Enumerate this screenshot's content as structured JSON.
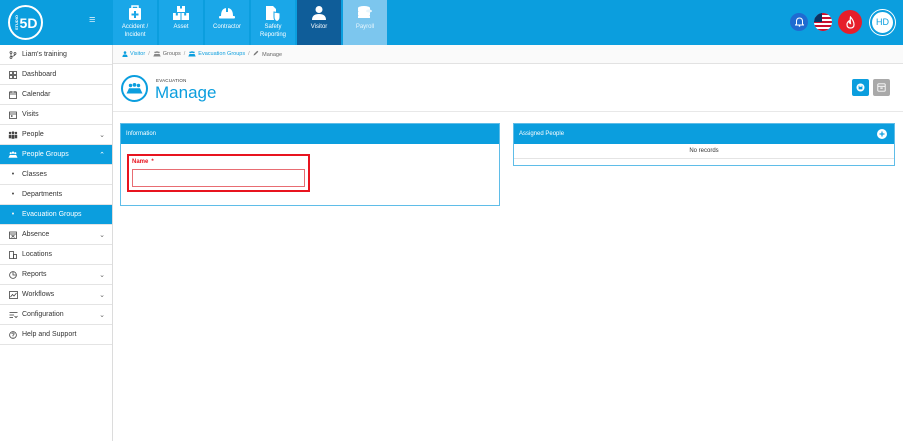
{
  "app": {
    "logo_text": "5D",
    "logo_small": "STUDIO",
    "user_initials": "HD"
  },
  "colors": {
    "primary": "#0b9ede",
    "module_active": "#0f5d99",
    "error": "#e8141f"
  },
  "modules": [
    {
      "label": "Accident / Incident",
      "icon": "first-aid-icon"
    },
    {
      "label": "Asset",
      "icon": "boxes-icon"
    },
    {
      "label": "Contractor",
      "icon": "hardhat-icon"
    },
    {
      "label": "Safety Reporting",
      "icon": "report-shield-icon"
    },
    {
      "label": "Visitor",
      "icon": "person-icon"
    },
    {
      "label": "Payroll",
      "icon": "coins-icon"
    }
  ],
  "sidebar": {
    "items": [
      {
        "label": "Liam's training",
        "icon": "branch-icon"
      },
      {
        "label": "Dashboard",
        "icon": "dashboard-icon"
      },
      {
        "label": "Calendar",
        "icon": "calendar-icon"
      },
      {
        "label": "Visits",
        "icon": "visits-icon"
      },
      {
        "label": "People",
        "icon": "people-icon"
      },
      {
        "label": "People Groups",
        "icon": "people-groups-icon"
      },
      {
        "label": "Classes",
        "icon": "bullet-icon"
      },
      {
        "label": "Departments",
        "icon": "bullet-icon"
      },
      {
        "label": "Evacuation Groups",
        "icon": "bullet-icon"
      },
      {
        "label": "Absence",
        "icon": "absence-icon"
      },
      {
        "label": "Locations",
        "icon": "locations-icon"
      },
      {
        "label": "Reports",
        "icon": "reports-icon"
      },
      {
        "label": "Workflows",
        "icon": "workflows-icon"
      },
      {
        "label": "Configuration",
        "icon": "configuration-icon"
      },
      {
        "label": "Help and Support",
        "icon": "help-icon"
      }
    ]
  },
  "breadcrumb": {
    "items": [
      "Visitor",
      "Groups",
      "Evacuation Groups",
      "Manage"
    ]
  },
  "page": {
    "subtitle": "EVACUATION",
    "title": "Manage"
  },
  "info_panel": {
    "title": "Information",
    "name_label": "Name",
    "required_mark": "*",
    "name_value": ""
  },
  "assigned_panel": {
    "title": "Assigned People",
    "empty_text": "No records"
  }
}
